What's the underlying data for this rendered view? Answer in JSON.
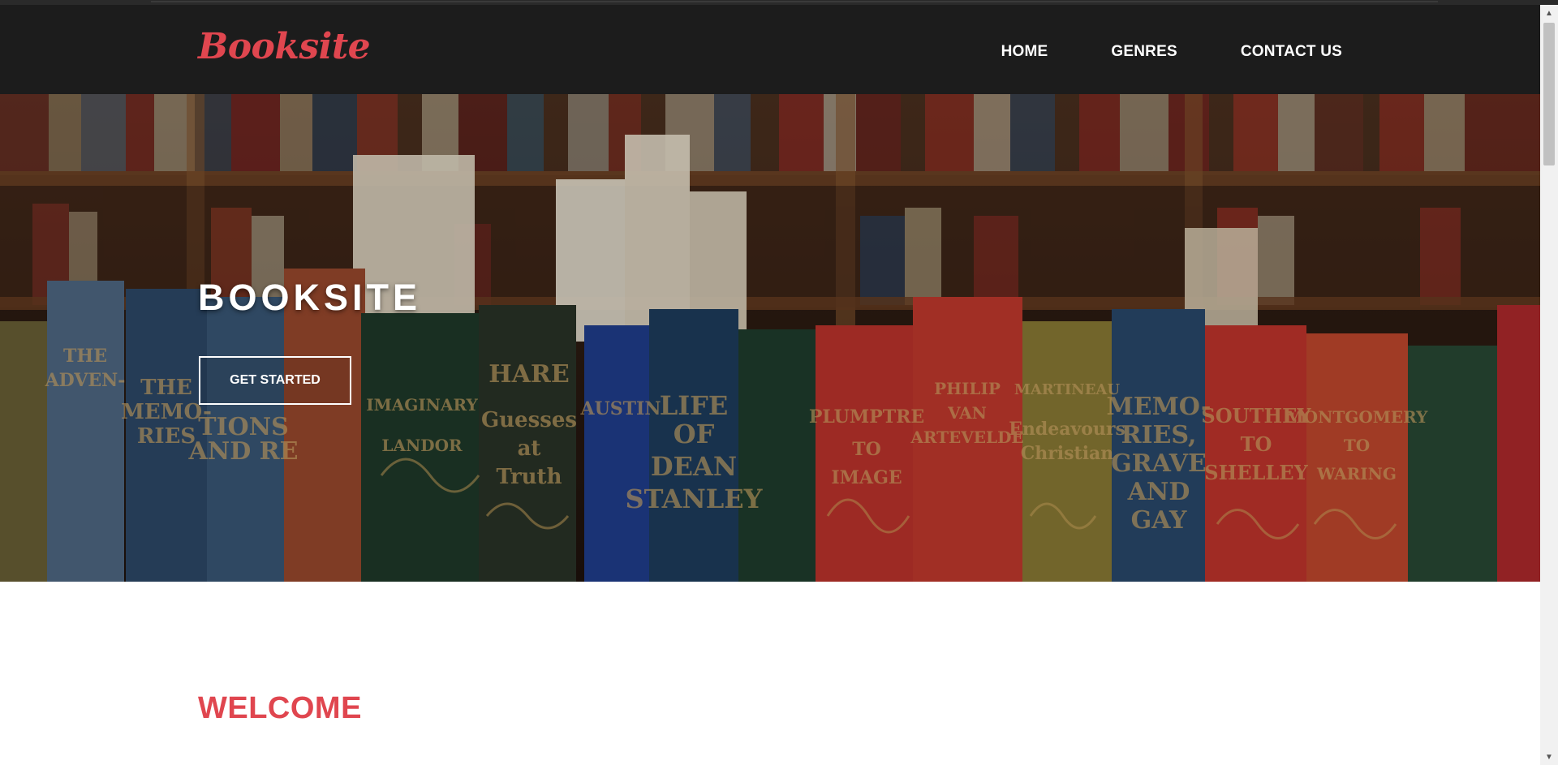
{
  "brand": {
    "logo_text": "Booksite",
    "accent_color": "#e0464f"
  },
  "nav": {
    "items": [
      {
        "label": "HOME"
      },
      {
        "label": "GENRES"
      },
      {
        "label": "CONTACT US"
      }
    ]
  },
  "hero": {
    "title": "BOOKSITE",
    "cta_label": "GET STARTED",
    "background": "bookshelf-photo"
  },
  "welcome": {
    "heading": "WELCOME"
  },
  "icons": {
    "scroll_up": "scroll-up-arrow-icon",
    "scroll_down": "scroll-down-arrow-icon"
  }
}
